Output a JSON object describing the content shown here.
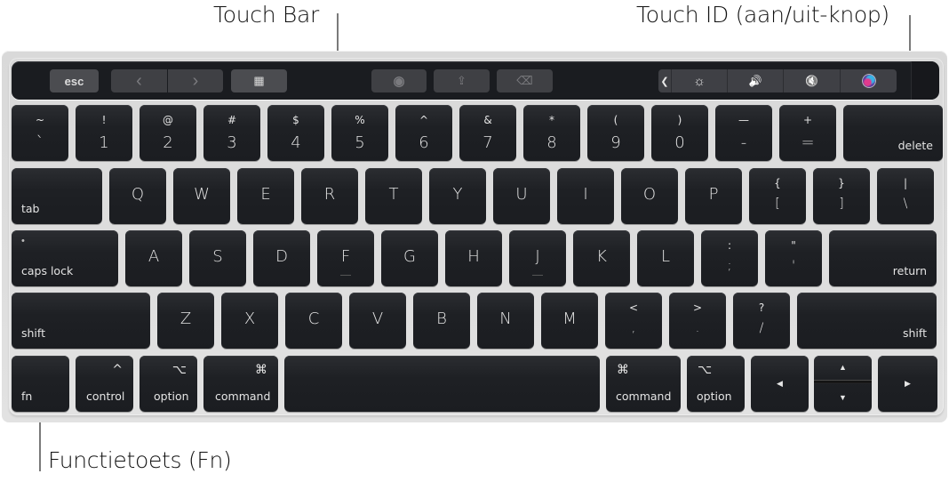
{
  "callouts": {
    "touch_bar": "Touch Bar",
    "touch_id": "Touch ID (aan/uit-knop)",
    "fn_key": "Functietoets (Fn)"
  },
  "touch_bar": {
    "esc": "esc",
    "back_icon": "‹",
    "forward_icon": "›",
    "grid_icon": "▦",
    "eye_icon": "◉",
    "share_icon": "⇪",
    "tag_icon": "⌫",
    "collapse_icon": "❮",
    "brightness_icon": "☼",
    "volume_icon": "🔊",
    "mute_icon": "🔇",
    "siri_icon": "siri"
  },
  "rows": {
    "row1": [
      {
        "top": "~",
        "main": "`"
      },
      {
        "top": "!",
        "main": "1"
      },
      {
        "top": "@",
        "main": "2"
      },
      {
        "top": "#",
        "main": "3"
      },
      {
        "top": "$",
        "main": "4"
      },
      {
        "top": "%",
        "main": "5"
      },
      {
        "top": "^",
        "main": "6"
      },
      {
        "top": "&",
        "main": "7"
      },
      {
        "top": "*",
        "main": "8"
      },
      {
        "top": "(",
        "main": "9"
      },
      {
        "top": ")",
        "main": "0"
      },
      {
        "top": "—",
        "main": "-"
      },
      {
        "top": "+",
        "main": "="
      },
      {
        "label": "delete"
      }
    ],
    "row2": [
      {
        "label": "tab"
      },
      {
        "main": "Q"
      },
      {
        "main": "W"
      },
      {
        "main": "E"
      },
      {
        "main": "R"
      },
      {
        "main": "T"
      },
      {
        "main": "Y"
      },
      {
        "main": "U"
      },
      {
        "main": "I"
      },
      {
        "main": "O"
      },
      {
        "main": "P"
      },
      {
        "top": "{",
        "main": "["
      },
      {
        "top": "}",
        "main": "]"
      },
      {
        "top": "|",
        "main": "\\"
      }
    ],
    "row3": [
      {
        "label": "caps lock",
        "indicator": "•"
      },
      {
        "main": "A"
      },
      {
        "main": "S"
      },
      {
        "main": "D"
      },
      {
        "main": "F"
      },
      {
        "main": "G"
      },
      {
        "main": "H"
      },
      {
        "main": "J"
      },
      {
        "main": "K"
      },
      {
        "main": "L"
      },
      {
        "top": ":",
        "main": ";"
      },
      {
        "top": "\"",
        "main": "'"
      },
      {
        "label": "return"
      }
    ],
    "row4": [
      {
        "label": "shift"
      },
      {
        "main": "Z"
      },
      {
        "main": "X"
      },
      {
        "main": "C"
      },
      {
        "main": "V"
      },
      {
        "main": "B"
      },
      {
        "main": "N"
      },
      {
        "main": "M"
      },
      {
        "top": "<",
        "main": ","
      },
      {
        "top": ">",
        "main": "."
      },
      {
        "top": "?",
        "main": "/"
      },
      {
        "label": "shift"
      }
    ],
    "row5": {
      "fn": "fn",
      "control": "control",
      "control_symbol": "^",
      "option": "option",
      "option_symbol": "⌥",
      "command": "command",
      "command_symbol": "⌘",
      "command_right": "command",
      "command_right_symbol": "⌘",
      "option_right": "option",
      "option_right_symbol": "⌥",
      "arrow_left": "◀",
      "arrow_up": "▲",
      "arrow_down": "▼",
      "arrow_right": "▶"
    }
  }
}
